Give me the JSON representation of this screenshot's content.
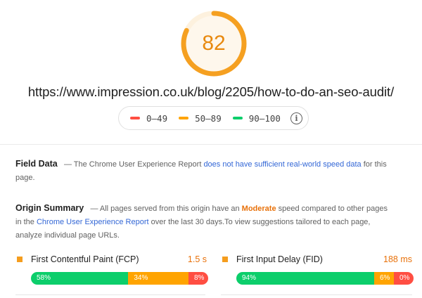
{
  "score": {
    "value": "82",
    "fraction": 0.82,
    "arc_color": "#f5a021",
    "track_color": "#fdf1de"
  },
  "url": "https://www.impression.co.uk/blog/2205/how-to-do-an-seo-audit/",
  "legend": {
    "items": [
      {
        "label": "0–49",
        "color": "#ff4e42"
      },
      {
        "label": "50–89",
        "color": "#ffa400"
      },
      {
        "label": "90–100",
        "color": "#0cce6b"
      }
    ],
    "info_icon": "info-circle-icon",
    "info_glyph": "i"
  },
  "field_data": {
    "heading": "Field Data",
    "dash": "—",
    "text_before": "The Chrome User Experience Report",
    "link": "does not have sufficient real-world speed data",
    "text_after": "for this page."
  },
  "origin_summary": {
    "heading": "Origin Summary",
    "dash": "—",
    "text_1": "All pages served from this origin have an",
    "rating": "Moderate",
    "text_2": "speed compared to other pages in the",
    "link": "Chrome User Experience Report",
    "text_3": "over the last 30 days.To view suggestions tailored to each page, analyze individual page URLs."
  },
  "metrics": [
    {
      "name": "First Contentful Paint (FCP)",
      "value": "1.5 s",
      "good_label": "58%",
      "good": 58,
      "avg_label": "34%",
      "avg": 34,
      "poor_label": "8%",
      "poor": 8
    },
    {
      "name": "First Input Delay (FID)",
      "value": "188 ms",
      "good_label": "94%",
      "good": 94,
      "avg_label": "6%",
      "avg": 6,
      "poor_label": "0%",
      "poor": 0
    }
  ],
  "colors": {
    "good": "#0cce6b",
    "average": "#ffa400",
    "poor": "#ff4e42",
    "link": "#3367d6",
    "moderate": "#e8710a"
  }
}
